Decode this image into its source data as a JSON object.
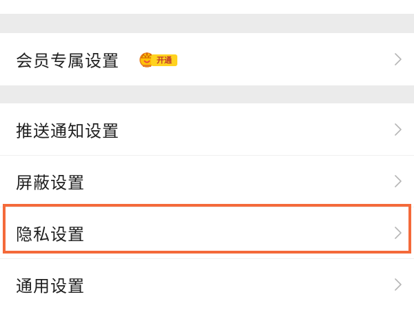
{
  "settings": {
    "items": [
      {
        "label": "会员专属设置",
        "badge": "开通"
      },
      {
        "label": "推送通知设置"
      },
      {
        "label": "屏蔽设置"
      },
      {
        "label": "隐私设置"
      },
      {
        "label": "通用设置"
      }
    ]
  },
  "colors": {
    "highlight": "#f46a3a",
    "badge_bg": "#ffd21f",
    "badge_text": "#c0392b",
    "separator": "#ebebeb"
  },
  "icons": {
    "chevron": "chevron-right-icon",
    "crown": "crown-icon"
  }
}
